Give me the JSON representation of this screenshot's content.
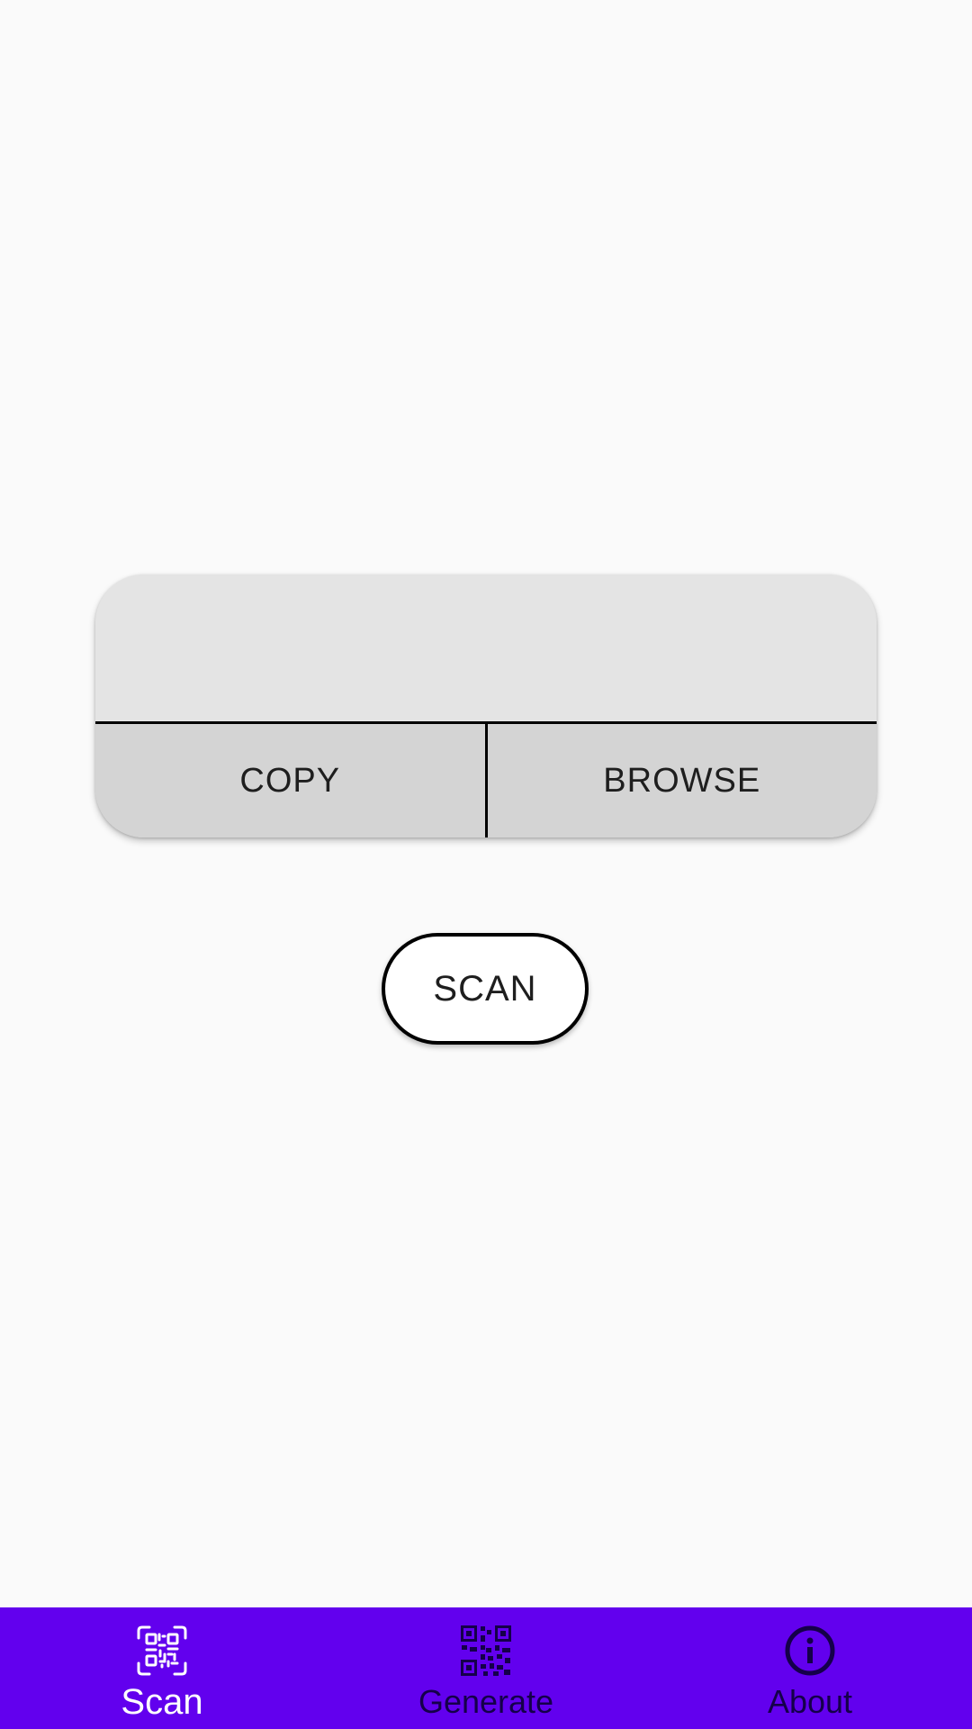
{
  "result_card": {
    "text": "",
    "copy_label": "COPY",
    "browse_label": "BROWSE"
  },
  "scan_button": {
    "label": "SCAN"
  },
  "bottom_nav": {
    "background": "#6200ee",
    "items": [
      {
        "label": "Scan",
        "icon": "qr-scan-icon",
        "active": true
      },
      {
        "label": "Generate",
        "icon": "qr-code-icon",
        "active": false
      },
      {
        "label": "About",
        "icon": "info-icon",
        "active": false
      }
    ]
  }
}
